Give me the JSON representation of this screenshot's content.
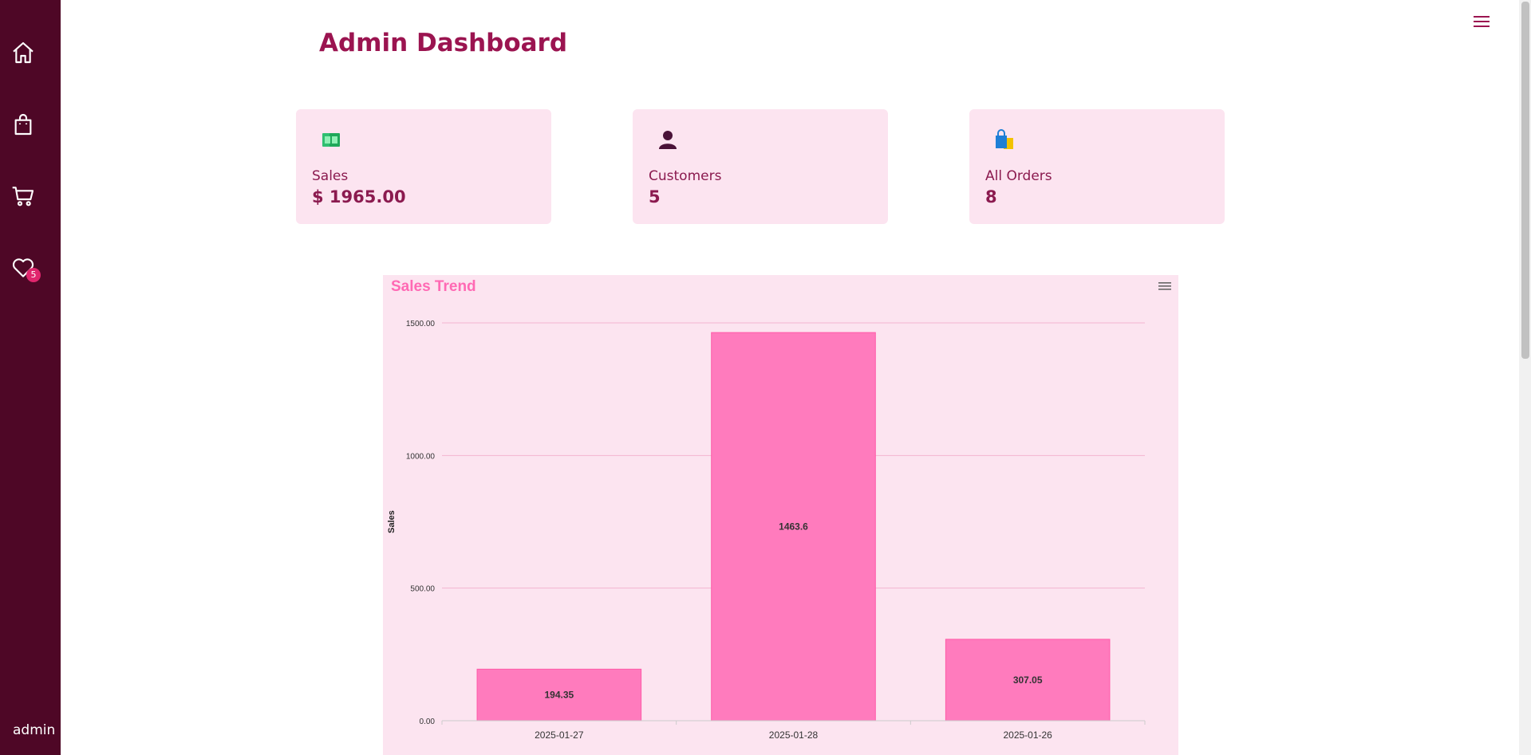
{
  "sidebar": {
    "items": [
      {
        "icon": "home-icon"
      },
      {
        "icon": "shopping-bag-icon"
      },
      {
        "icon": "cart-icon"
      },
      {
        "icon": "heart-icon",
        "badge": "5"
      }
    ],
    "user_label": "admin"
  },
  "header": {
    "title": "Admin Dashboard",
    "menu_icon": "hamburger-menu-icon"
  },
  "cards": [
    {
      "icon": "money-icon",
      "label": "Sales",
      "value": "$ 1965.00"
    },
    {
      "icon": "user-icon",
      "label": "Customers",
      "value": "5"
    },
    {
      "icon": "shopping-bags-icon",
      "label": "All Orders",
      "value": "8"
    }
  ],
  "colors": {
    "sidebar": "#4e0726",
    "accent": "#9b1450",
    "card_bg": "#fce4f0",
    "bar": "#ff7bbd",
    "chart_title": "#ff69b4"
  },
  "chart_data": {
    "type": "bar",
    "title": "Sales Trend",
    "ylabel": "Sales",
    "xlabel": "",
    "categories": [
      "2025-01-27",
      "2025-01-28",
      "2025-01-26"
    ],
    "values": [
      194.35,
      1463.6,
      307.05
    ],
    "data_labels": [
      "194.35",
      "1463.6",
      "307.05"
    ],
    "ylim": [
      0,
      1500
    ],
    "yticks": [
      0,
      500,
      1000,
      1500
    ],
    "ytick_labels": [
      "0.00",
      "500.00",
      "1000.00",
      "1500.00"
    ],
    "grid": true,
    "legend": false
  }
}
